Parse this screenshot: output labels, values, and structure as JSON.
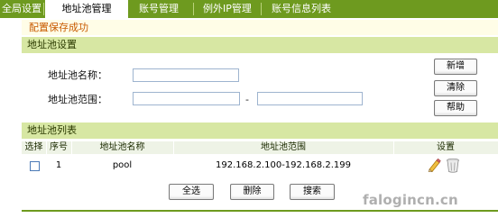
{
  "tabs": [
    {
      "label": "全局设置",
      "active": false
    },
    {
      "label": "地址池管理",
      "active": true
    },
    {
      "label": "账号管理",
      "active": false
    },
    {
      "label": "例外IP管理",
      "active": false
    },
    {
      "label": "账号信息列表",
      "active": false
    }
  ],
  "status_message": "配置保存成功",
  "pool_settings": {
    "section_title": "地址池设置",
    "name_label": "地址池名称：",
    "name_value": "",
    "range_label": "地址池范围：",
    "range_start": "",
    "range_separator": "-",
    "range_end": "",
    "buttons": {
      "add": "新增",
      "clear": "清除",
      "help": "帮助"
    }
  },
  "pool_list": {
    "section_title": "地址池列表",
    "columns": [
      "选择",
      "序号",
      "地址池名称",
      "地址池范围",
      "设置"
    ],
    "rows": [
      {
        "selected": false,
        "index": "1",
        "name": "pool",
        "range": "192.168.2.100-192.168.2.199",
        "actions": [
          "edit-icon",
          "delete-icon"
        ]
      }
    ],
    "buttons": {
      "select_all": "全选",
      "delete": "删除",
      "search": "搜索"
    }
  },
  "watermark": "falogincn.cn",
  "colors": {
    "tab_bar": "#6e9a1f",
    "section_header": "#d7e7a3",
    "status_text": "#c85a00",
    "message_bg": "#fffde7"
  }
}
